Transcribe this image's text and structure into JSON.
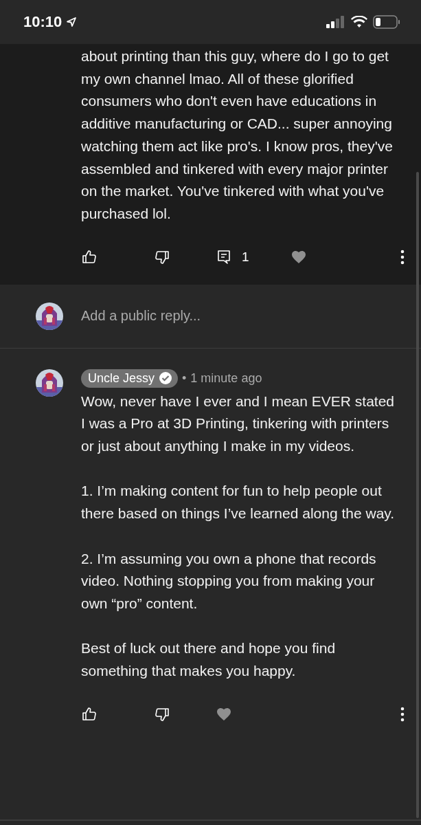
{
  "status_bar": {
    "time": "10:10"
  },
  "comments": [
    {
      "kind": "cut",
      "paragraphs": [
        "about printing than this guy, where do I go to get my own channel lmao. All of these glorified consumers who don't even have educations in additive manufacturing or CAD... super annoying watching them act like pro's. I know pros, they've assembled and tinkered with every major printer on the market. You've tinkered with what you've purchased lol."
      ],
      "reply_count": "1",
      "hearted": false
    },
    {
      "kind": "full",
      "author": "Uncle Jessy",
      "verified": true,
      "separator": "•",
      "time": "1 minute ago",
      "paragraphs": [
        "Wow, never have I ever and I mean EVER stated I was a Pro at 3D Printing, tinkering with printers or just about anything I make in my videos.",
        "1. I’m making content for fun to help people out there based on things I’ve learned along the way.",
        "2. I’m assuming you own a phone that records video. Nothing stopping you from making your own “pro” content.",
        "Best of luck out there and hope you find something that makes you happy."
      ],
      "hearted": false
    }
  ],
  "reply_field": {
    "placeholder": "Add a public reply..."
  }
}
